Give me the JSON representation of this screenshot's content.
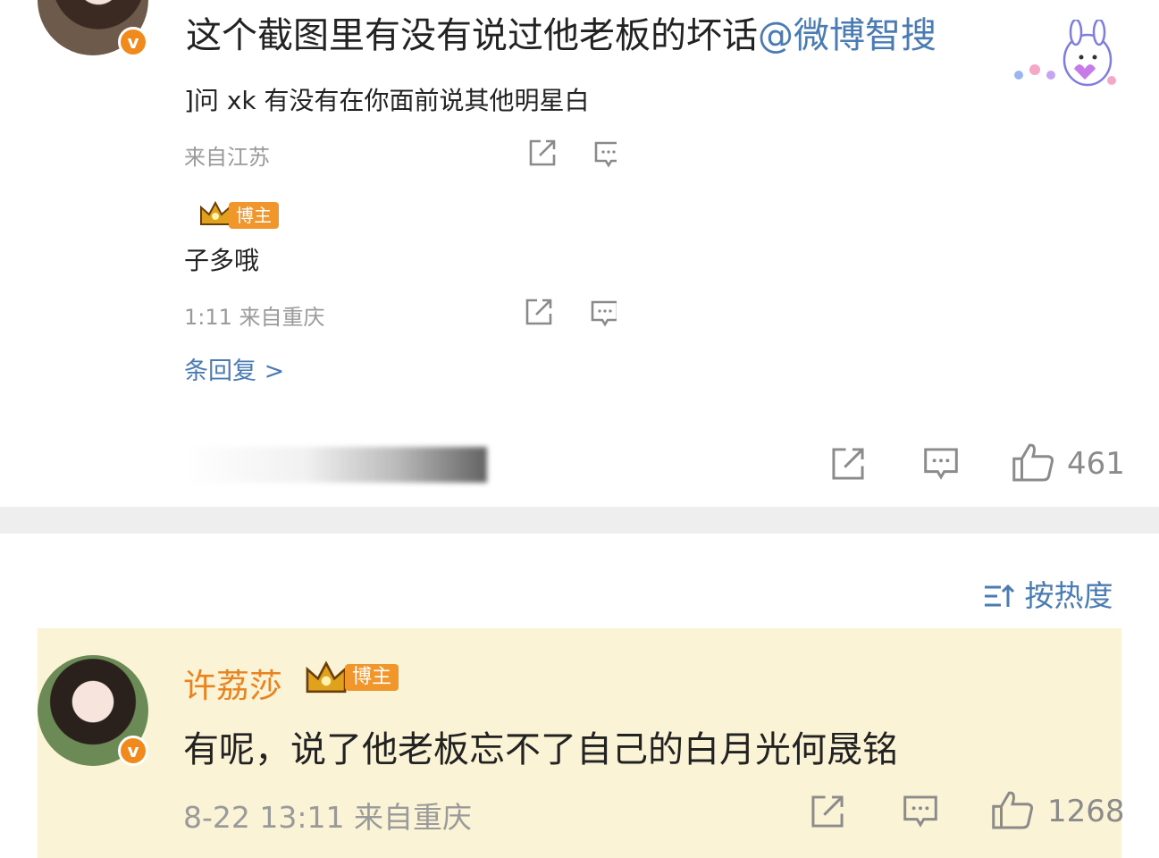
{
  "top_comment": {
    "text": "这个截图里有没有说过他老板的坏话",
    "mention": "@微博智搜",
    "likes": "461"
  },
  "embedded": {
    "line1": "]问 xk 有没有在你面前说其他明星白",
    "meta1": "来自江苏",
    "badge": "博主",
    "body": "子多哦",
    "meta2": "1:11  来自重庆",
    "reply": "条回复 >"
  },
  "sort": {
    "label": "按热度"
  },
  "highlight_comment": {
    "name": "许荔莎",
    "badge": "博主",
    "text": "有呢，说了他老板忘不了自己的白月光何晟铭",
    "meta": "8-22 13:11  来自重庆",
    "likes": "1268"
  },
  "colors": {
    "link": "#4a7bb2",
    "name": "#e8831f",
    "highlight_bg": "#fbf3d5",
    "separator": "#eeeeee"
  }
}
